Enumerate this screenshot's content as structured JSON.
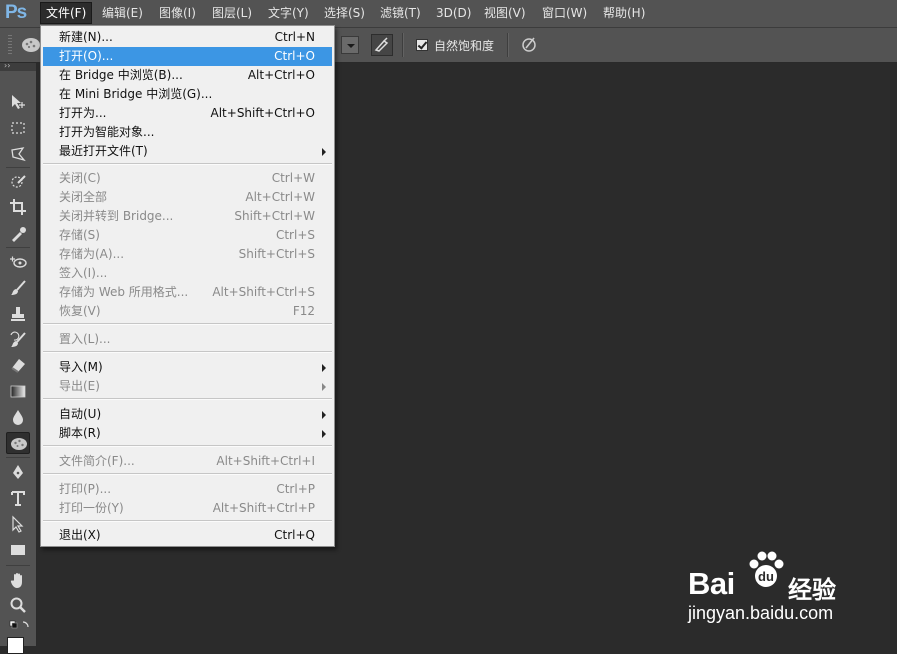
{
  "app": {
    "logo": "Ps"
  },
  "menubar": {
    "items": [
      "文件(F)",
      "编辑(E)",
      "图像(I)",
      "图层(L)",
      "文字(Y)",
      "选择(S)",
      "滤镜(T)",
      "3D(D)",
      "视图(V)",
      "窗口(W)",
      "帮助(H)"
    ],
    "active_index": 0
  },
  "options_bar": {
    "saturation_checkbox_label": "自然饱和度",
    "saturation_checked": true,
    "tool_icon": "sponge-icon",
    "airbrush_icon": "airbrush-icon",
    "pressure_icon": "pressure-icon"
  },
  "toolbox": {
    "tools": [
      "move-icon",
      "marquee-icon",
      "lasso-icon",
      "quick-select-icon",
      "crop-icon",
      "eyedropper-icon",
      "healing-icon",
      "brush-icon",
      "stamp-icon",
      "history-brush-icon",
      "eraser-icon",
      "gradient-icon",
      "blur-icon",
      "sponge-icon",
      "pen-icon",
      "type-icon",
      "path-select-icon",
      "rectangle-icon",
      "hand-icon",
      "zoom-icon"
    ],
    "selected_tool": "sponge-icon"
  },
  "file_menu": {
    "items": [
      {
        "label": "新建(N)...",
        "shortcut": "Ctrl+N"
      },
      {
        "label": "打开(O)...",
        "shortcut": "Ctrl+O",
        "highlight": true
      },
      {
        "label": "在 Bridge 中浏览(B)...",
        "shortcut": "Alt+Ctrl+O"
      },
      {
        "label": "在 Mini Bridge 中浏览(G)...",
        "shortcut": ""
      },
      {
        "label": "打开为...",
        "shortcut": "Alt+Shift+Ctrl+O"
      },
      {
        "label": "打开为智能对象...",
        "shortcut": ""
      },
      {
        "label": "最近打开文件(T)",
        "shortcut": "",
        "submenu": true
      },
      {
        "label": "关闭(C)",
        "shortcut": "Ctrl+W",
        "disabled": true
      },
      {
        "label": "关闭全部",
        "shortcut": "Alt+Ctrl+W",
        "disabled": true
      },
      {
        "label": "关闭并转到 Bridge...",
        "shortcut": "Shift+Ctrl+W",
        "disabled": true
      },
      {
        "label": "存储(S)",
        "shortcut": "Ctrl+S",
        "disabled": true
      },
      {
        "label": "存储为(A)...",
        "shortcut": "Shift+Ctrl+S",
        "disabled": true
      },
      {
        "label": "签入(I)...",
        "shortcut": "",
        "disabled": true
      },
      {
        "label": "存储为 Web 所用格式...",
        "shortcut": "Alt+Shift+Ctrl+S",
        "disabled": true
      },
      {
        "label": "恢复(V)",
        "shortcut": "F12",
        "disabled": true
      },
      {
        "label": "置入(L)...",
        "shortcut": "",
        "disabled": true
      },
      {
        "label": "导入(M)",
        "shortcut": "",
        "submenu": true
      },
      {
        "label": "导出(E)",
        "shortcut": "",
        "submenu": true,
        "disabled": true
      },
      {
        "label": "自动(U)",
        "shortcut": "",
        "submenu": true
      },
      {
        "label": "脚本(R)",
        "shortcut": "",
        "submenu": true
      },
      {
        "label": "文件简介(F)...",
        "shortcut": "Alt+Shift+Ctrl+I",
        "disabled": true
      },
      {
        "label": "打印(P)...",
        "shortcut": "Ctrl+P",
        "disabled": true
      },
      {
        "label": "打印一份(Y)",
        "shortcut": "Alt+Shift+Ctrl+P",
        "disabled": true
      },
      {
        "label": "退出(X)",
        "shortcut": "Ctrl+Q"
      }
    ]
  },
  "watermark": {
    "brand": "Bai",
    "brand_cn": "经验",
    "url": "jingyan.baidu.com"
  },
  "colors": {
    "menubar_bg": "#535353",
    "workspace_bg": "#2b2b2b",
    "menu_bg": "#f0f0f0",
    "highlight": "#3c96e4",
    "ps_logo": "#7fb6e6"
  }
}
